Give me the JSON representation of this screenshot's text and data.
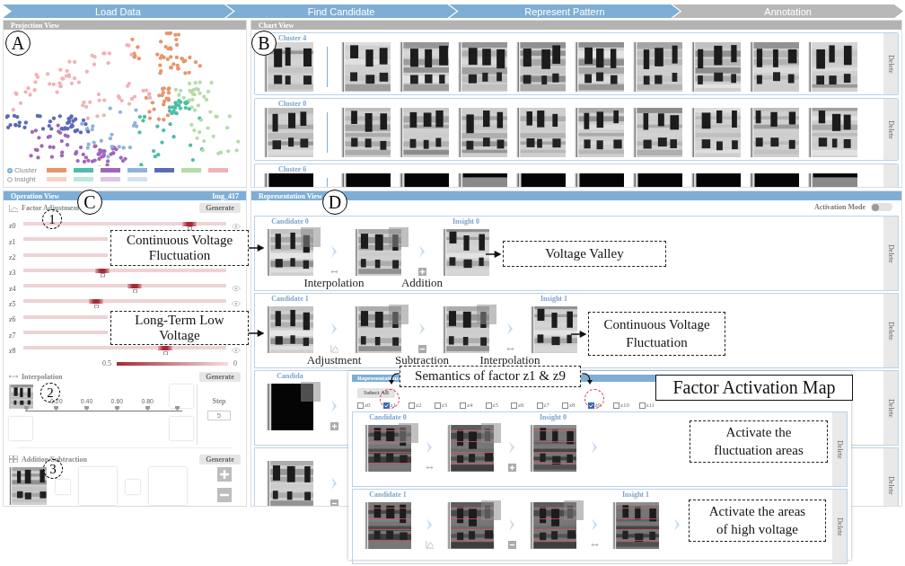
{
  "steps": [
    {
      "label": "Load Data",
      "active": true
    },
    {
      "label": "Find Candidate",
      "active": true
    },
    {
      "label": "Represent Pattern",
      "active": true
    },
    {
      "label": "Annotation",
      "active": false
    }
  ],
  "projection_view": {
    "title": "Projection View",
    "legend": [
      {
        "label": "Cluster",
        "selected": true,
        "swatches": [
          {
            "color": "#e8956a"
          },
          {
            "color": "#4dbda6"
          },
          {
            "color": "#a066b8"
          },
          {
            "color": "#8fb3dc"
          },
          {
            "color": "#5b6bb5"
          },
          {
            "color": "#b5dca8"
          },
          {
            "color": "#f0b2b8"
          }
        ]
      },
      {
        "label": "Insight",
        "selected": false,
        "swatches": [
          {
            "color": "#f6d3c0"
          },
          {
            "color": "#bde6dd"
          },
          {
            "color": "#dcc5e5"
          },
          {
            "color": "#d3e2f1"
          }
        ]
      }
    ]
  },
  "chart_view": {
    "title": "Chart View",
    "clusters": [
      {
        "label": "Cluster 4",
        "action": "Delete",
        "thumbnails": [
          {
            "kind": "heatmap"
          },
          {
            "kind": "heatmap"
          },
          {
            "kind": "heatmap"
          },
          {
            "kind": "heatmap"
          },
          {
            "kind": "heatmap"
          },
          {
            "kind": "heatmap"
          },
          {
            "kind": "heatmap"
          },
          {
            "kind": "heatmap"
          },
          {
            "kind": "heatmap"
          },
          {
            "kind": "heatmap"
          }
        ]
      },
      {
        "label": "Cluster 0",
        "action": "Delete",
        "thumbnails": [
          {
            "kind": "heatmap"
          },
          {
            "kind": "heatmap"
          },
          {
            "kind": "heatmap"
          },
          {
            "kind": "heatmap"
          },
          {
            "kind": "heatmap"
          },
          {
            "kind": "heatmap"
          },
          {
            "kind": "heatmap"
          },
          {
            "kind": "heatmap"
          },
          {
            "kind": "heatmap"
          },
          {
            "kind": "heatmap"
          }
        ]
      },
      {
        "label": "Cluster 6",
        "thumbnails": [
          {
            "kind": "dark"
          },
          {
            "kind": "dark"
          },
          {
            "kind": "dark"
          },
          {
            "kind": "split"
          },
          {
            "kind": "dark"
          },
          {
            "kind": "dark"
          },
          {
            "kind": "dark"
          },
          {
            "kind": "dark"
          },
          {
            "kind": "dark"
          },
          {
            "kind": "split"
          }
        ]
      }
    ]
  },
  "operation_view": {
    "title": "Operation View",
    "image": "Img_417",
    "factor_adjustment": {
      "title": "Factor Adjustment",
      "button": "Generate",
      "factors": [
        {
          "label": "z0",
          "level": 0.82,
          "eye": true
        },
        {
          "label": "z1",
          "eye": false
        },
        {
          "label": "z2",
          "eye": false
        },
        {
          "label": "z3",
          "level": 0.39,
          "eye": false
        },
        {
          "label": "z4",
          "level": 0.55,
          "eye": true
        },
        {
          "label": "z5",
          "level": 0.36,
          "eye": true
        },
        {
          "label": "z6",
          "eye": false
        },
        {
          "label": "z7",
          "eye": false
        },
        {
          "label": "z8",
          "level": 0.7,
          "eye": true
        }
      ],
      "scale_max": "0.5",
      "scale_min": "0"
    },
    "interpolation": {
      "title": "Interpolation",
      "button": "Generate",
      "ticks": [
        "0.20",
        "0.40",
        "0.60",
        "0.80"
      ],
      "step_label": "Step",
      "step_value": "5"
    },
    "addition_subtraction": {
      "title": "Addition/Subtraction",
      "button": "Generate"
    }
  },
  "representation_view": {
    "title": "Representation View",
    "activation_mode": {
      "label": "Activation Mode",
      "on": false
    },
    "rows": [
      {
        "action": "Delete",
        "trailing_chevron": false,
        "steps": [
          {
            "label": "Candidate 0",
            "kind": "heatmap",
            "patch": true
          },
          {
            "kind": "heatmap",
            "patch": true,
            "op": {
              "kind": "interpolation",
              "label": "Interpolation"
            }
          },
          {
            "label": "Insight 0",
            "kind": "heatmap",
            "patch": false,
            "op": {
              "kind": "addition",
              "label": "Addition"
            }
          }
        ]
      },
      {
        "action": "Delete",
        "trailing_chevron": false,
        "steps": [
          {
            "label": "Candidate 1",
            "kind": "heatmap",
            "patch": false
          },
          {
            "kind": "heatmap",
            "patch": true,
            "op": {
              "kind": "adjustment",
              "label": "Adjustment"
            }
          },
          {
            "kind": "heatmap",
            "patch": true,
            "op": {
              "kind": "subtraction",
              "label": "Subtraction"
            }
          },
          {
            "label": "Insight 1",
            "kind": "heatmap",
            "patch": false,
            "op": {
              "kind": "interpolation",
              "label": "Interpolation"
            }
          }
        ]
      },
      {
        "action": "Delete",
        "trailing_chevron": false,
        "steps": [
          {
            "label": "Candida",
            "kind": "dark",
            "patch": true
          },
          {
            "op": {
              "kind": "addition"
            }
          }
        ]
      },
      {
        "action": "Delete",
        "trailing_chevron": false,
        "steps": [
          {
            "kind": "heatmap",
            "patch": false
          },
          {
            "op": {
              "kind": "subtraction"
            }
          }
        ]
      }
    ]
  },
  "activation_panel": {
    "title": "Representation",
    "select_all": "Select All",
    "factors": [
      {
        "label": "z0",
        "checked": false
      },
      {
        "label": "z1",
        "checked": true
      },
      {
        "label": "z2",
        "checked": false
      },
      {
        "label": "z3",
        "checked": false
      },
      {
        "label": "z4",
        "checked": false
      },
      {
        "label": "z5",
        "checked": false
      },
      {
        "label": "z6",
        "checked": false
      },
      {
        "label": "z7",
        "checked": false
      },
      {
        "label": "z8",
        "checked": false
      },
      {
        "label": "z9",
        "checked": true
      },
      {
        "label": "z10",
        "checked": false
      },
      {
        "label": "z11",
        "checked": false
      }
    ],
    "rows": [
      {
        "action": "Delete",
        "trailing_chevron": true,
        "steps": [
          {
            "label": "Candidate 0",
            "kind": "activation",
            "patch": true
          },
          {
            "kind": "activation",
            "patch": true,
            "op": {
              "kind": "interpolation"
            }
          },
          {
            "label": "Insight 0",
            "kind": "activation",
            "patch": false,
            "op": {
              "kind": "addition"
            }
          }
        ]
      },
      {
        "action": "Delete",
        "trailing_chevron": true,
        "steps": [
          {
            "label": "Candidate 1",
            "kind": "activation",
            "patch": false
          },
          {
            "kind": "activation",
            "patch": true,
            "op": {
              "kind": "adjustment"
            }
          },
          {
            "kind": "activation",
            "patch": true,
            "op": {
              "kind": "subtraction"
            }
          },
          {
            "label": "Insight 1",
            "kind": "activation",
            "patch": false,
            "op": {
              "kind": "interpolation"
            }
          }
        ]
      }
    ]
  },
  "annotations": {
    "letters": [
      "A",
      "B",
      "C",
      "D"
    ],
    "numbers": [
      "1",
      "2",
      "3"
    ],
    "title": "Factor Activation Map",
    "callouts": [
      {
        "text": "Continuous Voltage Fluctuation",
        "arrow": true
      },
      {
        "text": "Long-Term Low Voltage",
        "arrow": true
      },
      {
        "text": "Voltage Valley",
        "arrow": true
      },
      {
        "text": "Continuous Voltage Fluctuation",
        "arrow": true
      },
      {
        "text": "Semantics of factor z1 & z9",
        "arrow": true
      },
      {
        "text": "Activate the fluctuation areas",
        "arrow": false
      },
      {
        "text": "Activate the areas of high voltage",
        "arrow": false
      }
    ]
  }
}
